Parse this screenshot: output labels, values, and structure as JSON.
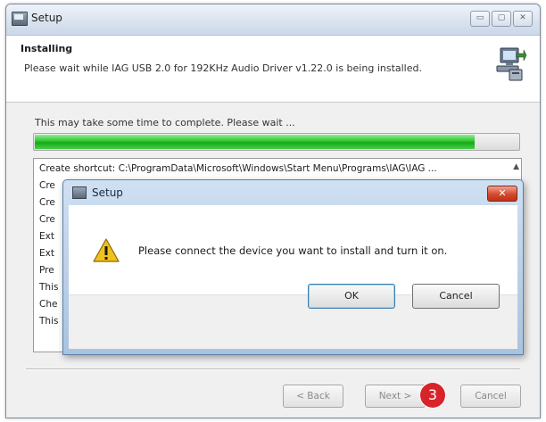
{
  "window": {
    "title": "Setup",
    "minimize_glyph": "▭",
    "maximize_glyph": "▢",
    "close_glyph": "✕"
  },
  "header": {
    "title": "Installing",
    "subtitle": "Please wait while IAG USB 2.0 for 192KHz Audio Driver v1.22.0 is being installed.",
    "icon": "installer-computer-icon"
  },
  "body": {
    "info_text": "This may take some time to complete. Please wait ...",
    "progress_fraction": 0.91,
    "progress_color": "#2fc42f",
    "log_lines": [
      "Create shortcut: C:\\ProgramData\\Microsoft\\Windows\\Start Menu\\Programs\\IAG\\IAG ...",
      "Cre",
      "Cre",
      "Cre",
      "Ext",
      "Ext",
      "Pre",
      "This",
      "Che",
      "This"
    ],
    "scroll_up_glyph": "▲"
  },
  "footer": {
    "back_label": "< Back",
    "next_label": "Next >",
    "cancel_label": "Cancel"
  },
  "badge": {
    "number": "3",
    "color": "#d7242a"
  },
  "dialog": {
    "title": "Setup",
    "close_glyph": "✕",
    "message": "Please connect the device you want to install and turn it on.",
    "icon": "warning-icon",
    "ok_label": "OK",
    "cancel_label": "Cancel"
  }
}
